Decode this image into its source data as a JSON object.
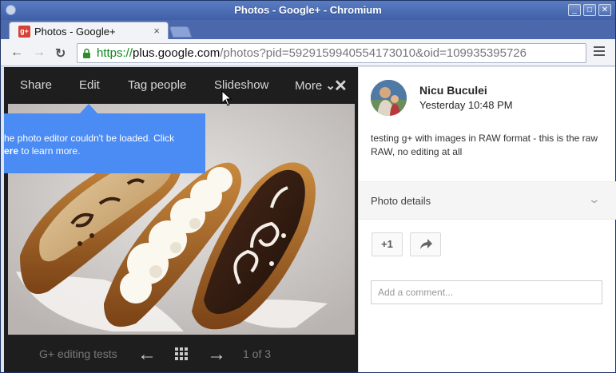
{
  "window": {
    "title": "Photos - Google+ - Chromium",
    "buttons": [
      "_",
      "□",
      "✕"
    ]
  },
  "tab": {
    "favicon_text": "g+",
    "label": "Photos - Google+",
    "close": "×"
  },
  "toolbar": {
    "back": "←",
    "forward": "→",
    "reload": "↻",
    "url_scheme": "https://",
    "url_host": "plus.google.com",
    "url_path": "/photos?pid=5929159940554173010&oid=109935395726"
  },
  "lightbox": {
    "nav": {
      "share": "Share",
      "edit": "Edit",
      "tag_people": "Tag people",
      "slideshow": "Slideshow",
      "more": "More",
      "more_chevron": "⌄",
      "close": "✕"
    },
    "error_tip": {
      "line1": "he photo editor couldn't be loaded. Click",
      "line2_bold": "ere",
      "line2_rest": " to learn more."
    },
    "album_name": "G+ editing tests",
    "prev": "←",
    "next": "→",
    "counter": "1 of 3"
  },
  "post": {
    "author": "Nicu Buculei",
    "time": "Yesterday 10:48 PM",
    "text": "testing g+ with images in RAW format - this is the raw RAW, no editing at all",
    "photo_details_label": "Photo details",
    "photo_details_chevron": "⌄",
    "plus_one": "+1",
    "comment_placeholder": "Add a comment..."
  },
  "colors": {
    "accent_blue": "#4b8bf4",
    "secure_green": "#0a8a1e",
    "lightbox_bg": "#1e1e1e"
  }
}
